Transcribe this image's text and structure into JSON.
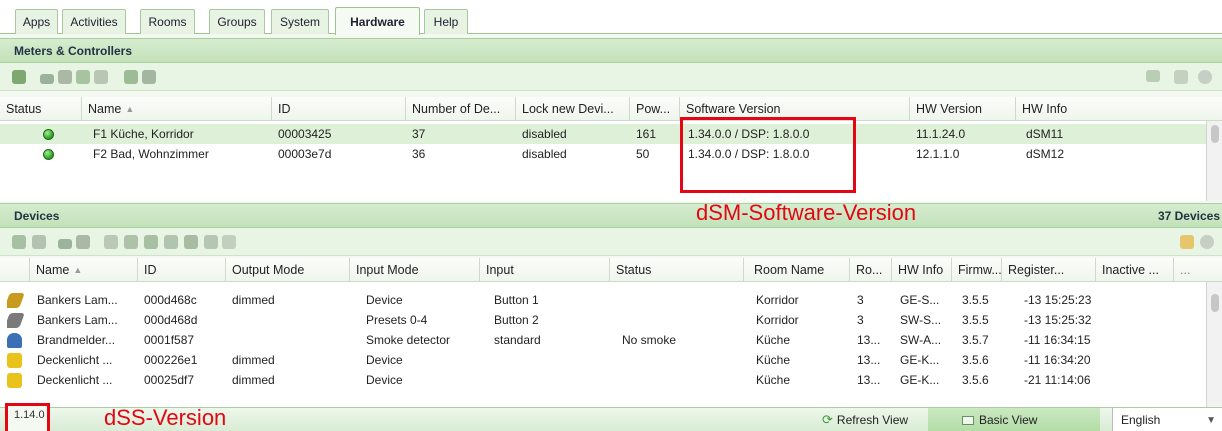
{
  "tabs": [
    "Apps",
    "Activities",
    "Rooms",
    "Groups",
    "System",
    "Hardware",
    "Help"
  ],
  "meters": {
    "title": "Meters & Controllers",
    "columns": [
      "Status",
      "Name",
      "ID",
      "Number of De...",
      "Lock new Devi...",
      "Pow...",
      "Software Version",
      "HW Version",
      "HW Info"
    ],
    "rows": [
      {
        "name": "F1 Küche, Korridor",
        "id": "00003425",
        "devices": "37",
        "lock": "disabled",
        "power": "161",
        "software": "1.34.0.0 / DSP: 1.8.0.0",
        "hw_version": "11.1.24.0",
        "hw_info": "dSM11"
      },
      {
        "name": "F2 Bad, Wohnzimmer",
        "id": "00003e7d",
        "devices": "36",
        "lock": "disabled",
        "power": "50",
        "software": "1.34.0.0 / DSP: 1.8.0.0",
        "hw_version": "12.1.1.0",
        "hw_info": "dSM12"
      }
    ]
  },
  "devices": {
    "title": "Devices",
    "count": "37 Devices",
    "columns": [
      "Name",
      "ID",
      "Output Mode",
      "Input Mode",
      "Input",
      "Status",
      "Room Name",
      "Ro...",
      "HW Info",
      "Firmw...",
      "Register...",
      "Inactive ...",
      "..."
    ],
    "rows": [
      {
        "icon_color": "#c89a1e",
        "name": "Bankers Lam...",
        "id": "000d468c",
        "output": "dimmed",
        "input_mode": "Device",
        "input": "Button 1",
        "status": "",
        "room": "Korridor",
        "ro": "3",
        "hw": "GE-S...",
        "fw": "3.5.5",
        "reg": "-13 15:25:23"
      },
      {
        "icon_color": "#7a7a7a",
        "name": "Bankers Lam...",
        "id": "000d468d",
        "output": "",
        "input_mode": "Presets 0-4",
        "input": "Button 2",
        "status": "",
        "room": "Korridor",
        "ro": "3",
        "hw": "SW-S...",
        "fw": "3.5.5",
        "reg": "-13 15:25:32"
      },
      {
        "icon_color": "#3b6fb6",
        "name": "Brandmelder...",
        "id": "0001f587",
        "output": "",
        "input_mode": "Smoke detector",
        "input": "standard",
        "status": "No smoke",
        "room": "Küche",
        "ro": "13...",
        "hw": "SW-A...",
        "fw": "3.5.7",
        "reg": "-11 16:34:15"
      },
      {
        "icon_color": "#e9c21b",
        "name": "Deckenlicht ...",
        "id": "000226e1",
        "output": "dimmed",
        "input_mode": "Device",
        "input": "",
        "status": "",
        "room": "Küche",
        "ro": "13...",
        "hw": "GE-K...",
        "fw": "3.5.6",
        "reg": "-11 16:34:20"
      },
      {
        "icon_color": "#e9c21b",
        "name": "Deckenlicht ...",
        "id": "00025df7",
        "output": "dimmed",
        "input_mode": "Device",
        "input": "",
        "status": "",
        "room": "Küche",
        "ro": "13...",
        "hw": "GE-K...",
        "fw": "3.5.6",
        "reg": "-21 11:14:06"
      }
    ]
  },
  "annotations": {
    "dsm": "dSM-Software-Version",
    "dss": "dSS-Version"
  },
  "statusbar": {
    "version": "1.14.0",
    "refresh": "Refresh View",
    "basic": "Basic View",
    "language": "English"
  }
}
